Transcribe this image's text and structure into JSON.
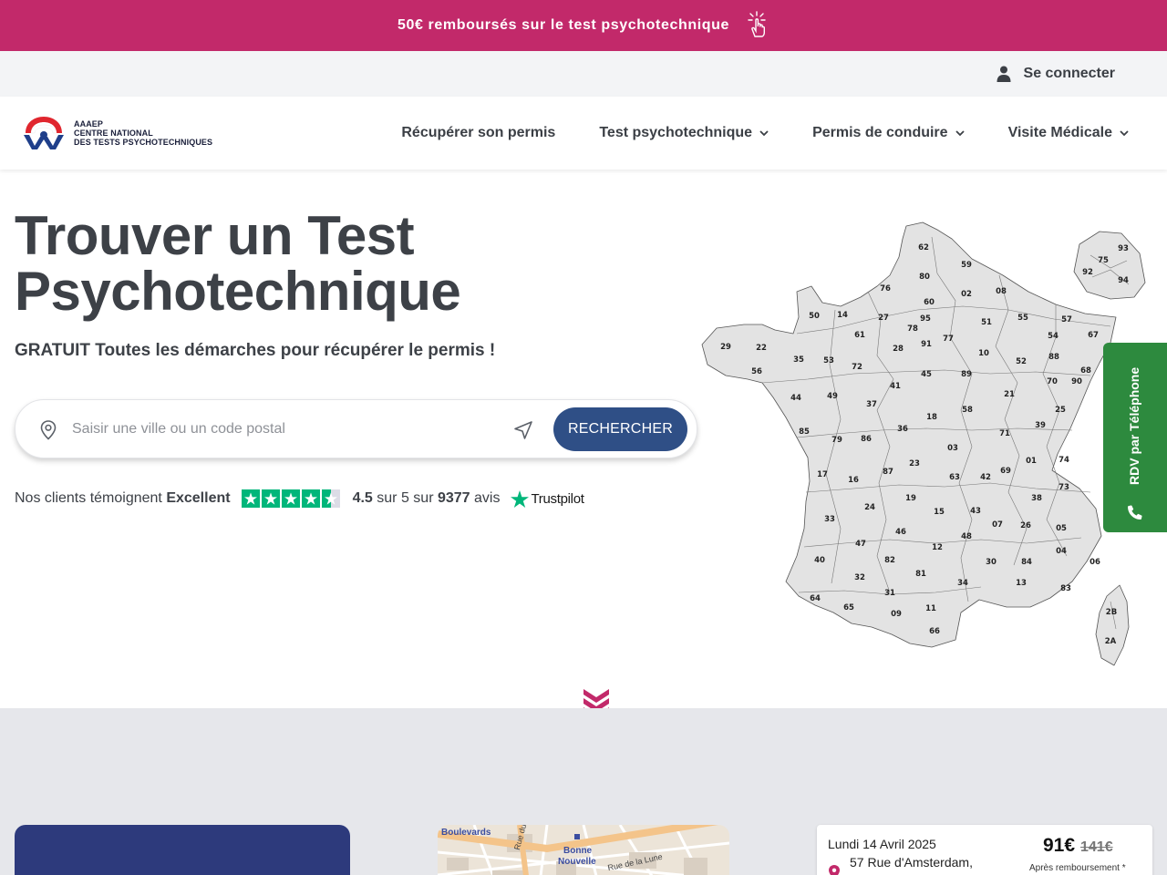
{
  "promo": {
    "text": "50€ remboursés sur le test psychotechnique",
    "icon": "tap-hand-icon"
  },
  "account": {
    "login_label": "Se connecter",
    "icon": "user-icon"
  },
  "logo": {
    "line1": "AAAEP",
    "line2": "CENTRE NATIONAL",
    "line3": "DES TESTS PSYCHOTECHNIQUES"
  },
  "nav": {
    "items": [
      {
        "label": "Récupérer son permis",
        "has_dropdown": false
      },
      {
        "label": "Test psychotechnique",
        "has_dropdown": true
      },
      {
        "label": "Permis de conduire",
        "has_dropdown": true
      },
      {
        "label": "Visite Médicale",
        "has_dropdown": true
      }
    ]
  },
  "hero": {
    "title_line1": "Trouver un Test",
    "title_line2": "Psychotechnique",
    "subtitle": "GRATUIT Toutes les démarches pour récupérer le permis !"
  },
  "search": {
    "placeholder": "Saisir une ville ou un code postal",
    "value": "",
    "button_label": "RECHERCHER"
  },
  "reviews": {
    "prefix": "Nos clients témoignent",
    "rating_word": "Excellent",
    "score": "4.5",
    "score_suffix": "sur 5 sur",
    "count": "9377",
    "count_suffix": "avis",
    "stars_value": 4.5,
    "stars_max": 5,
    "brand": "Trustpilot"
  },
  "map": {
    "departments": [
      "62",
      "59",
      "80",
      "02",
      "08",
      "76",
      "60",
      "50",
      "14",
      "27",
      "95",
      "51",
      "55",
      "57",
      "67",
      "93",
      "75",
      "92",
      "94",
      "29",
      "22",
      "61",
      "78",
      "91",
      "77",
      "54",
      "35",
      "56",
      "53",
      "72",
      "28",
      "10",
      "52",
      "88",
      "68",
      "44",
      "49",
      "37",
      "41",
      "45",
      "89",
      "21",
      "70",
      "90",
      "36",
      "18",
      "58",
      "25",
      "85",
      "79",
      "86",
      "71",
      "39",
      "03",
      "01",
      "74",
      "17",
      "16",
      "87",
      "23",
      "63",
      "42",
      "69",
      "24",
      "19",
      "15",
      "43",
      "38",
      "73",
      "33",
      "46",
      "07",
      "26",
      "05",
      "47",
      "12",
      "48",
      "40",
      "82",
      "81",
      "30",
      "84",
      "04",
      "06",
      "32",
      "13",
      "64",
      "65",
      "31",
      "34",
      "83",
      "09",
      "11",
      "66",
      "2B",
      "2A"
    ]
  },
  "side_tab": {
    "label": "RDV par Téléphone",
    "icon": "phone-icon",
    "color": "#2d8a3e"
  },
  "map_thumb": {
    "labels": [
      "Boulevards",
      "Bonne",
      "Nouvelle"
    ],
    "streets": [
      "Rue de la Lune",
      "Rue du Sentier"
    ]
  },
  "slot": {
    "date": "Lundi 14 Avril 2025",
    "address": "57 Rue d'Amsterdam,",
    "price": "91€",
    "old_price": "141€",
    "note": "Après remboursement *"
  },
  "colors": {
    "brand_pink": "#c2296a",
    "brand_blue": "#2f4f86",
    "trustpilot_green": "#00b67a"
  }
}
